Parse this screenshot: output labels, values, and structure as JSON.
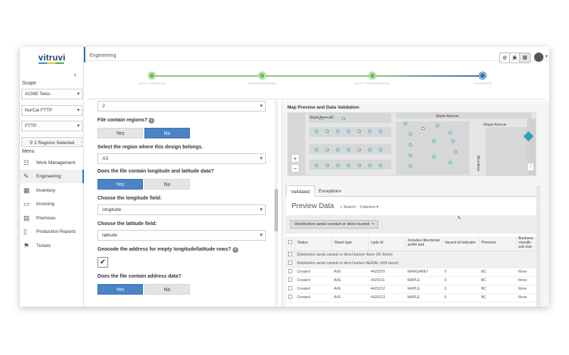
{
  "app": {
    "logo": "vitruvi",
    "page_title": "Engineering"
  },
  "sidebar": {
    "collapse_icon": "chevron-left-icon",
    "scope_label": "Scope",
    "dropdowns": [
      "ACME Telco",
      "NorCal FTTP",
      "FTTP"
    ],
    "regions_button": "2 Regions Selected",
    "menu_label": "Menu",
    "items": [
      {
        "label": "Work Management",
        "icon": "sitemap-icon"
      },
      {
        "label": "Engineering",
        "icon": "wrench-icon",
        "active": true
      },
      {
        "label": "Inventory",
        "icon": "cubes-icon"
      },
      {
        "label": "Invoicing",
        "icon": "money-icon"
      },
      {
        "label": "Premises",
        "icon": "building-icon"
      },
      {
        "label": "Production Reports",
        "icon": "file-icon"
      },
      {
        "label": "Tickets",
        "icon": "flag-icon"
      }
    ]
  },
  "stepper": {
    "steps": [
      {
        "label": "DATA SOURCE",
        "state": "done"
      },
      {
        "label": "DATA MAPPING",
        "state": "done"
      },
      {
        "label": "DATA PROCESSING",
        "state": "done"
      },
      {
        "label": "FINISHED",
        "state": "current"
      }
    ],
    "colors": {
      "done": "#6abf4b",
      "current": "#2c6fb3"
    }
  },
  "form": {
    "top_select": "2",
    "q_regions": "File contain regions?",
    "region_question": "Select the region where this design belongs.",
    "region_select": "A3",
    "q_latlong": "Does the file contain longitude and latitude data?",
    "q_longitude": "Choose the longitude field:",
    "longitude_select": "longitude",
    "q_latitude": "Choose the latitude field:",
    "latitude_select": "latitude",
    "q_geocode": "Geocode the address for empty longitude/latitude rows?",
    "geocode_checked": "✔",
    "q_address": "Does the file contain address data?",
    "yes": "Yes",
    "no": "No"
  },
  "map": {
    "title": "Map Preview and Data Validation",
    "streets": [
      "Maple Avenue",
      "Maple Avenue",
      "Maple Avenue",
      "Woodbine"
    ],
    "zoom_in": "+",
    "zoom_out": "−"
  },
  "tabs": [
    "Validated",
    "Exceptions"
  ],
  "preview": {
    "title": "Preview Data",
    "search": "Search",
    "columns": "Columns",
    "group_chip": "Distribution aerial conduit or direct buried",
    "chip_close": "×",
    "headers": [
      "Status",
      "Street type",
      "Lpds Id",
      "Includes directional prefix and",
      "Vacant lot indicator",
      "Province",
      "Business classific sub clas"
    ],
    "group_rows": [
      "Distribution aerial conduit or direct buried: None (25 Items)",
      "Distribution aerial conduit or direct buried: AERIAL (409 Items)"
    ],
    "rows": [
      [
        "Created",
        "AVE",
        "4420370",
        "MARGARET",
        "0",
        "BC",
        "None"
      ],
      [
        "Created",
        "AVE",
        "4420211",
        "MAPLE",
        "0",
        "BC",
        "None"
      ],
      [
        "Created",
        "AVE",
        "4420212",
        "MAPLE",
        "0",
        "BC",
        "None"
      ],
      [
        "Created",
        "AVE",
        "4420213",
        "MAPLE",
        "0",
        "BC",
        "None"
      ]
    ]
  }
}
